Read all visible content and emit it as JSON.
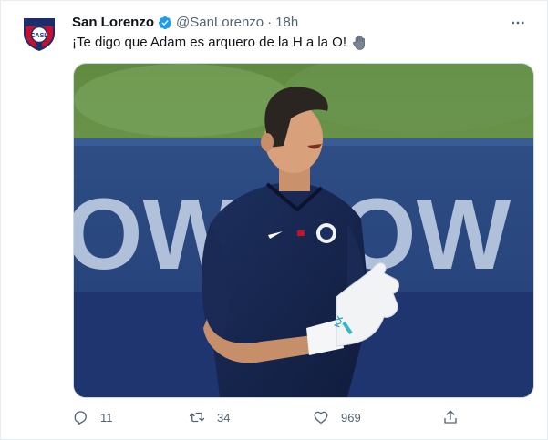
{
  "tweet": {
    "author_name": "San Lorenzo",
    "handle": "@SanLorenzo",
    "separator": "·",
    "time": "18h",
    "text": "¡Te digo que Adam es arquero de la H a la O!",
    "emoji": "glove-emoji",
    "media": {
      "banner_text": "OW OW",
      "subject": "goalkeeper"
    }
  },
  "actions": {
    "reply_count": "11",
    "retweet_count": "34",
    "like_count": "969"
  },
  "colors": {
    "verified": "#1d9bf0",
    "secondary_text": "#536471",
    "border": "#e6ecf0"
  },
  "icons": [
    "club-crest-icon",
    "verified-icon",
    "more-icon",
    "reply-icon",
    "retweet-icon",
    "like-icon",
    "share-icon"
  ]
}
